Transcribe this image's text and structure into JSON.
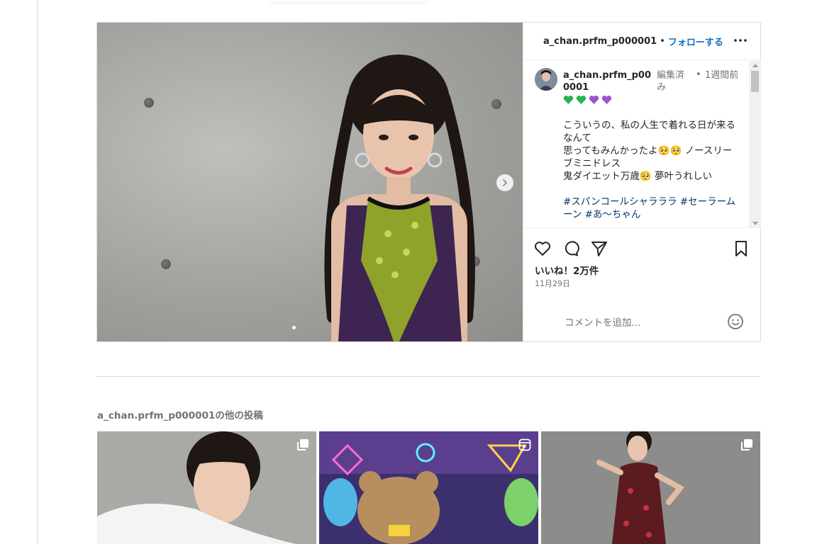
{
  "post": {
    "username": "a_chan.prfm_p000001",
    "separator": "•",
    "follow_label": "フォローする",
    "caption": {
      "username": "a_chan.prfm_p000001",
      "edited_label": "編集済み",
      "dot": "•",
      "time": "1週間前",
      "hearts": [
        "green-heart",
        "green-heart",
        "purple-heart",
        "purple-heart"
      ],
      "body": "こういうの、私の人生で着れる日が来るなんて\n思ってもみんかったよ🥺🥺 ノースリーブミニドレス\n鬼ダイエット万歳🥺 夢叶うれしい",
      "hashtags": "#スパンコールシャラララ #セーラームーン #あ〜ちゃん"
    },
    "likes_text": "いいね！2万件",
    "date_text": "11月29日",
    "comment_placeholder": "コメントを追加...",
    "carousel_index": 1
  },
  "more_posts": {
    "title": "a_chan.prfm_p000001の他の投稿",
    "items": [
      {
        "type": "carousel",
        "icon": "carousel-icon"
      },
      {
        "type": "reel",
        "icon": "reel-icon"
      },
      {
        "type": "carousel",
        "icon": "carousel-icon"
      }
    ]
  },
  "colors": {
    "link": "#0b6ec4",
    "hashtag": "#00376b",
    "muted": "#737373",
    "border": "#dbdbdb"
  }
}
